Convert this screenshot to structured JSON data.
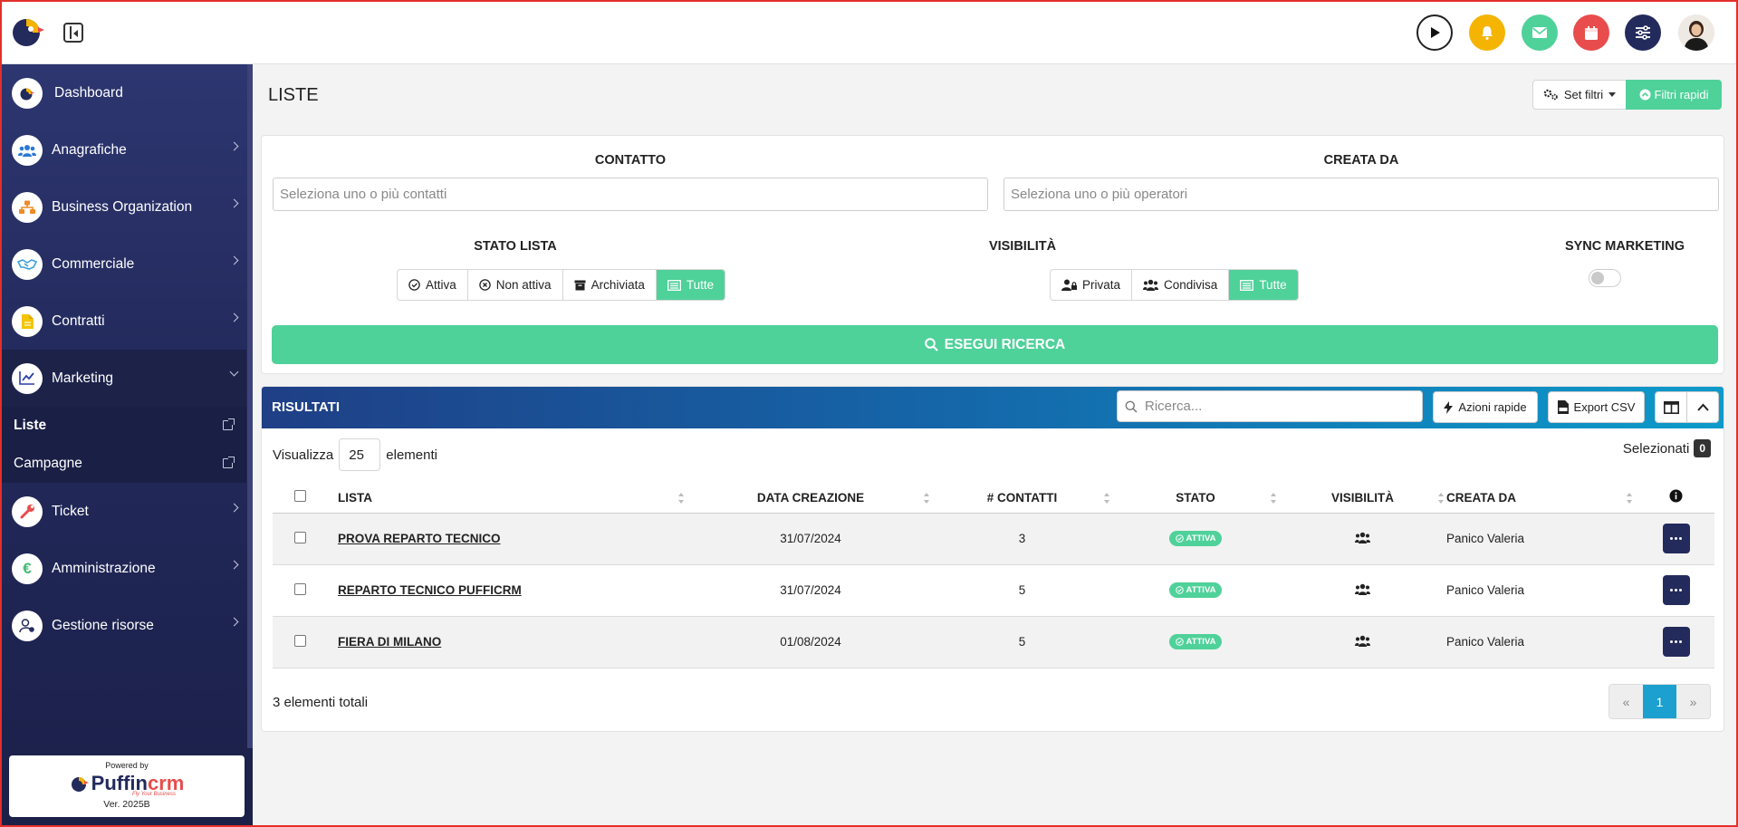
{
  "topbar": {
    "icons": [
      "play-icon",
      "bell-icon",
      "mail-icon",
      "calendar-icon",
      "settings-sliders-icon",
      "avatar"
    ]
  },
  "sidebar": {
    "items": [
      {
        "label": "Dashboard",
        "icon": "dashboard-logo-icon"
      },
      {
        "label": "Anagrafiche",
        "icon": "users-icon"
      },
      {
        "label": "Business Organization",
        "icon": "org-chart-icon"
      },
      {
        "label": "Commerciale",
        "icon": "handshake-icon"
      },
      {
        "label": "Contratti",
        "icon": "document-icon"
      },
      {
        "label": "Marketing",
        "icon": "chart-line-icon"
      },
      {
        "label": "Ticket",
        "icon": "wrench-icon"
      },
      {
        "label": "Amministrazione",
        "icon": "euro-icon"
      },
      {
        "label": "Gestione risorse",
        "icon": "user-gear-icon"
      }
    ],
    "subitems": [
      {
        "label": "Liste"
      },
      {
        "label": "Campagne"
      }
    ],
    "powered": {
      "by": "Powered by",
      "brand": "Puffin",
      "brand_suffix": "crm",
      "tagline": "Fly Your Business",
      "version": "Ver. 2025B"
    }
  },
  "page": {
    "title": "LISTE",
    "set_filtri": "Set filtri",
    "filtri_rapidi": "Filtri rapidi"
  },
  "filters": {
    "contatto_label": "CONTATTO",
    "contatto_placeholder": "Seleziona uno o più contatti",
    "creata_label": "CREATA DA",
    "creata_placeholder": "Seleziona uno o più operatori",
    "stato_label": "STATO LISTA",
    "stato_options": [
      "Attiva",
      "Non attiva",
      "Archiviata",
      "Tutte"
    ],
    "stato_selected": "Tutte",
    "visibilita_label": "VISIBILITÀ",
    "visibilita_options": [
      "Privata",
      "Condivisa",
      "Tutte"
    ],
    "visibilita_selected": "Tutte",
    "sync_label": "SYNC MARKETING",
    "sync_on": false,
    "search_button": "ESEGUI RICERCA"
  },
  "results": {
    "title": "RISULTATI",
    "search_placeholder": "Ricerca...",
    "azioni": "Azioni rapide",
    "export": "Export CSV",
    "show_prefix": "Visualizza",
    "show_value": "25",
    "show_suffix": "elementi",
    "selected_label": "Selezionati",
    "selected_count": "0",
    "columns": [
      "LISTA",
      "DATA CREAZIONE",
      "# CONTATTI",
      "STATO",
      "VISIBILITÀ",
      "CREATA DA"
    ],
    "rows": [
      {
        "lista": "PROVA REPARTO TECNICO",
        "data": "31/07/2024",
        "contatti": "3",
        "stato": "ATTIVA",
        "creata": "Panico Valeria"
      },
      {
        "lista": "REPARTO TECNICO PUFFICRM",
        "data": "31/07/2024",
        "contatti": "5",
        "stato": "ATTIVA",
        "creata": "Panico Valeria"
      },
      {
        "lista": "FIERA DI MILANO",
        "data": "01/08/2024",
        "contatti": "5",
        "stato": "ATTIVA",
        "creata": "Panico Valeria"
      }
    ],
    "total": "3 elementi totali",
    "pager": {
      "prev": "«",
      "current": "1",
      "next": "»"
    }
  },
  "colors": {
    "accent": "#4fd19a",
    "navy": "#232a5c",
    "blue": "#1ba0cf",
    "red": "#e84c4c",
    "yellow": "#f4b400"
  }
}
